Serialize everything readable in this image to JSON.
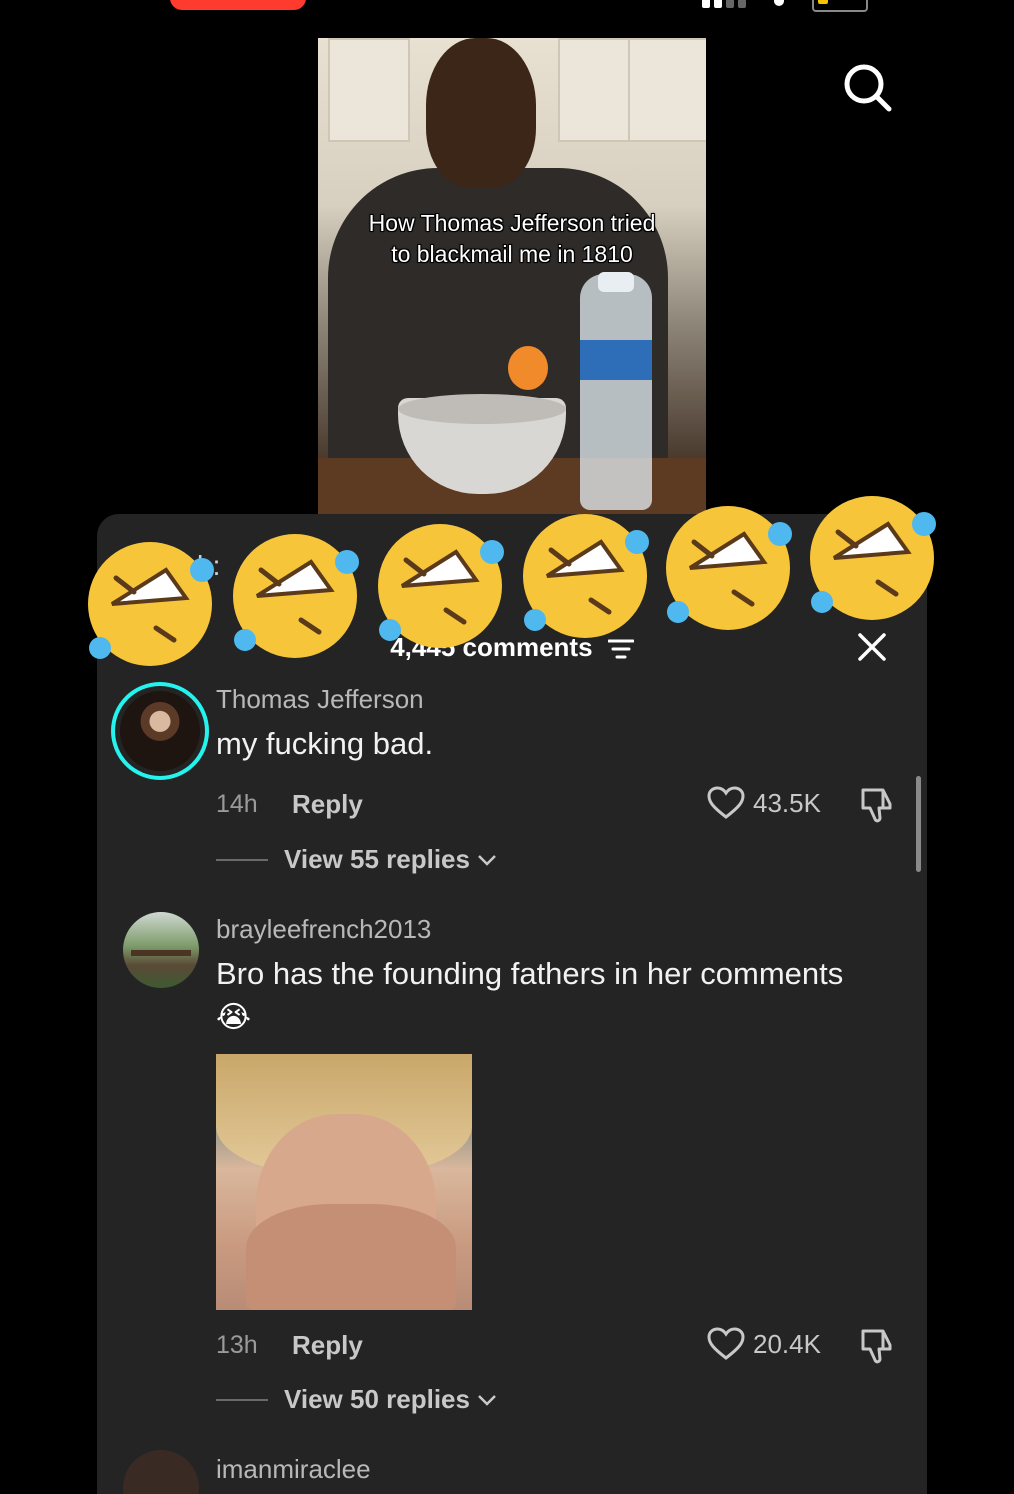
{
  "status_bar": {
    "battery_color": "#f5c400",
    "recording_color": "#ff3b30"
  },
  "video": {
    "caption_line1": "How Thomas Jefferson tried",
    "caption_line2": "to blackmail me in 1810",
    "search_icon": "search-icon"
  },
  "sheet": {
    "hidden_header": "h:",
    "comments_count": "4,445 comments",
    "filter_icon": "filter-icon",
    "close_icon": "close-icon"
  },
  "overlay": {
    "emoji": "rolling-on-floor-laughing",
    "count": 6
  },
  "comments": [
    {
      "username": "Thomas Jefferson",
      "text": "my fucking bad.",
      "time": "14h",
      "reply_label": "Reply",
      "likes": "43.5K",
      "view_replies": "View 55 replies"
    },
    {
      "username": "brayleefrench2013",
      "text": "Bro has the founding fathers in her comments",
      "emoji": "😭",
      "time": "13h",
      "reply_label": "Reply",
      "likes": "20.4K",
      "view_replies": "View 50 replies"
    },
    {
      "username": "imanmiraclee"
    }
  ],
  "colors": {
    "sheet_bg": "#242424",
    "avatar_ring": "#25f4ee"
  }
}
